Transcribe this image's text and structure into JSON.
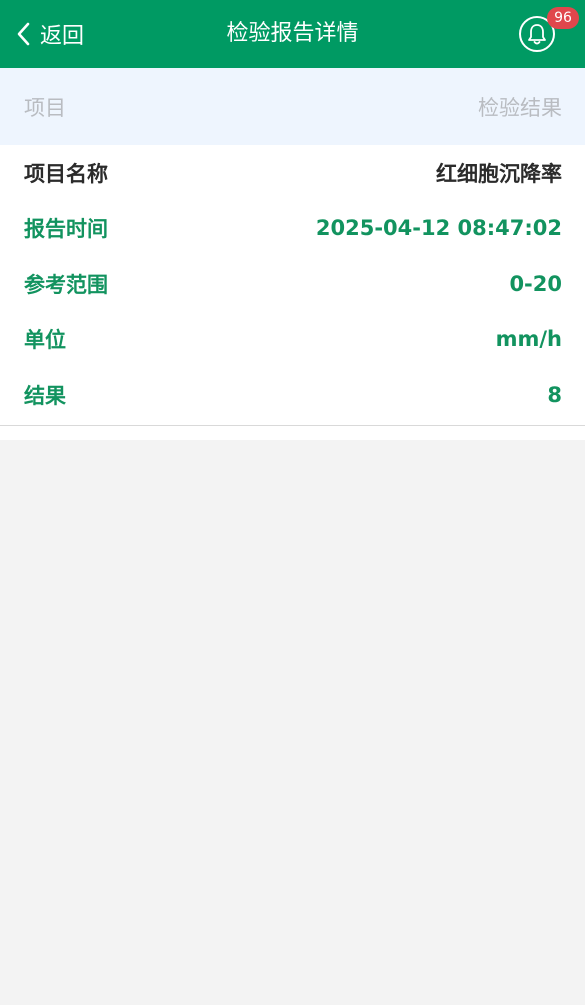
{
  "header": {
    "back_label": "返回",
    "title": "检验报告详情",
    "notification_count": "96"
  },
  "table_header": {
    "item": "项目",
    "result": "检验结果"
  },
  "details": [
    {
      "label": "项目名称",
      "value": "红细胞沉降率"
    },
    {
      "label": "报告时间",
      "value": "2025-04-12 08:47:02"
    },
    {
      "label": "参考范围",
      "value": "0-20"
    },
    {
      "label": "单位",
      "value": "mm/h"
    },
    {
      "label": "结果",
      "value": "8"
    }
  ],
  "colors": {
    "header_bg": "#009a63",
    "accent_green": "#12935f",
    "badge_red": "#e0474c",
    "header_row_bg": "#eef5fe"
  }
}
